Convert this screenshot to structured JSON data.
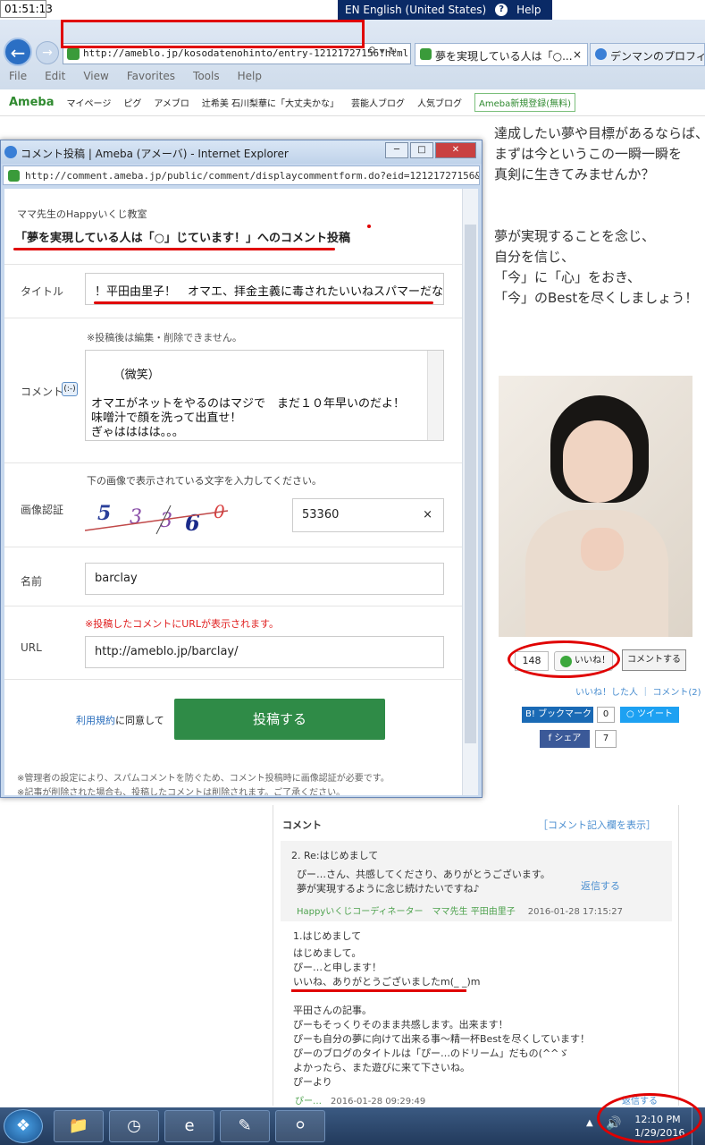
{
  "top_clock": "01:51:13",
  "language_bar": {
    "lang": "EN English (United States)",
    "help": "Help"
  },
  "browser": {
    "address": "http://ameblo.jp/kosodatenohinto/entry-12121727156.html",
    "tabs": [
      {
        "label": "夢を実現している人は「○...",
        "close": "×"
      },
      {
        "label": "デンマンのプロフィ"
      }
    ],
    "menu": [
      "File",
      "Edit",
      "View",
      "Favorites",
      "Tools",
      "Help"
    ]
  },
  "ameba_bar": {
    "logo": "Ameba",
    "items": [
      "マイページ",
      "ピグ",
      "アメブロ",
      "辻希美 石川梨華に「大丈夫かな」",
      "芸能人ブログ",
      "人気ブログ"
    ],
    "register": "Ameba新規登録(無料)"
  },
  "blog": {
    "lines1": [
      "達成したい夢や目標があるならば、",
      "まずは今というこの一瞬一瞬を",
      "真剣に生きてみませんか？"
    ],
    "lines2": [
      "夢が実現することを念じ、",
      "自分を信じ、",
      "「今」に「心」をおき、",
      "「今」のBestを尽くしましょう！"
    ],
    "like_count": "148",
    "like_label": "いいね！",
    "comment_label": "コメントする",
    "like_links": "いいね！した人 ｜ コメント(2)",
    "bookmark": "ブックマーク",
    "bookmark_count": "0",
    "tweet": "ツイート",
    "share": "シェア",
    "share_count": "7"
  },
  "popup": {
    "title": "コメント投稿 | Ameba (アメーバ) - Internet Explorer",
    "url": "http://comment.ameba.jp/public/comment/displaycommentform.do?eid=12121727156&bnm=",
    "blog_name": "ママ先生のHappyいくじ教室",
    "heading": "「夢を実現している人は「○」じています！」へのコメント投稿",
    "labels": {
      "title": "タイトル",
      "comment": "コメント",
      "captcha": "画像認証",
      "name": "名前",
      "url": "URL"
    },
    "title_value": "！平田由里子！　オマエ、拝金主義に毒されたいいねスパマーだな！",
    "comment_note": "※投稿後は編集・削除できません。",
    "comment_value": "（微笑）\n\nオマエがネットをやるのはマジで　まだ１０年早いのだよ！\n味噌汁で顔を洗って出直せ！\nぎゃはははは。。。",
    "emoji": "(:-)",
    "captcha_note": "下の画像で表示されている文字を入力してください。",
    "captcha_chars": [
      "5",
      "3",
      "3",
      "6",
      "0"
    ],
    "captcha_value": "53360",
    "name_value": "barclay",
    "url_note": "※投稿したコメントにURLが表示されます。",
    "url_value": "http://ameblo.jp/barclay/",
    "terms_link": "利用規約",
    "terms_text": "に同意して",
    "submit": "投稿する",
    "footnote1": "※管理者の設定により、スパムコメントを防ぐため、コメント投稿時に画像認証が必要です。",
    "footnote2": "※記事が削除された場合も、投稿したコメントは削除されます。ご了承ください。"
  },
  "comments": {
    "header": "コメント",
    "show_form": "［コメント記入欄を表示］",
    "reply": {
      "title": "2. Re:はじめまして",
      "text1": "ぴー…さん、共感してくださり、ありがとうございます。",
      "text2": "夢が実現するように念じ続けたいですね♪",
      "send": "返信する",
      "author": "Happyいくじコーディネーター　ママ先生 平田由里子",
      "date": "2016-01-28 17:15:27"
    },
    "c1": {
      "title": "1.はじめまして",
      "text": "はじめまして。\nぴー…と申します！\nいいね、ありがとうございましたm(_ _)m\n\n平田さんの記事。\nぴーもそっくりそのまま共感します。出来ます！\nぴーも自分の夢に向けて出来る事〜精一杯Bestを尽くしています！\nぴーのブログのタイトルは「ぴー…のドリーム」だもの(^^ゞ\nよかったら、また遊びに来て下さいね。\nぴーより",
      "author": "ぴー…",
      "date": "2016-01-28 09:29:49",
      "reply": "返信する"
    }
  },
  "taskbar": {
    "time": "12:10 PM",
    "date": "1/29/2016"
  }
}
